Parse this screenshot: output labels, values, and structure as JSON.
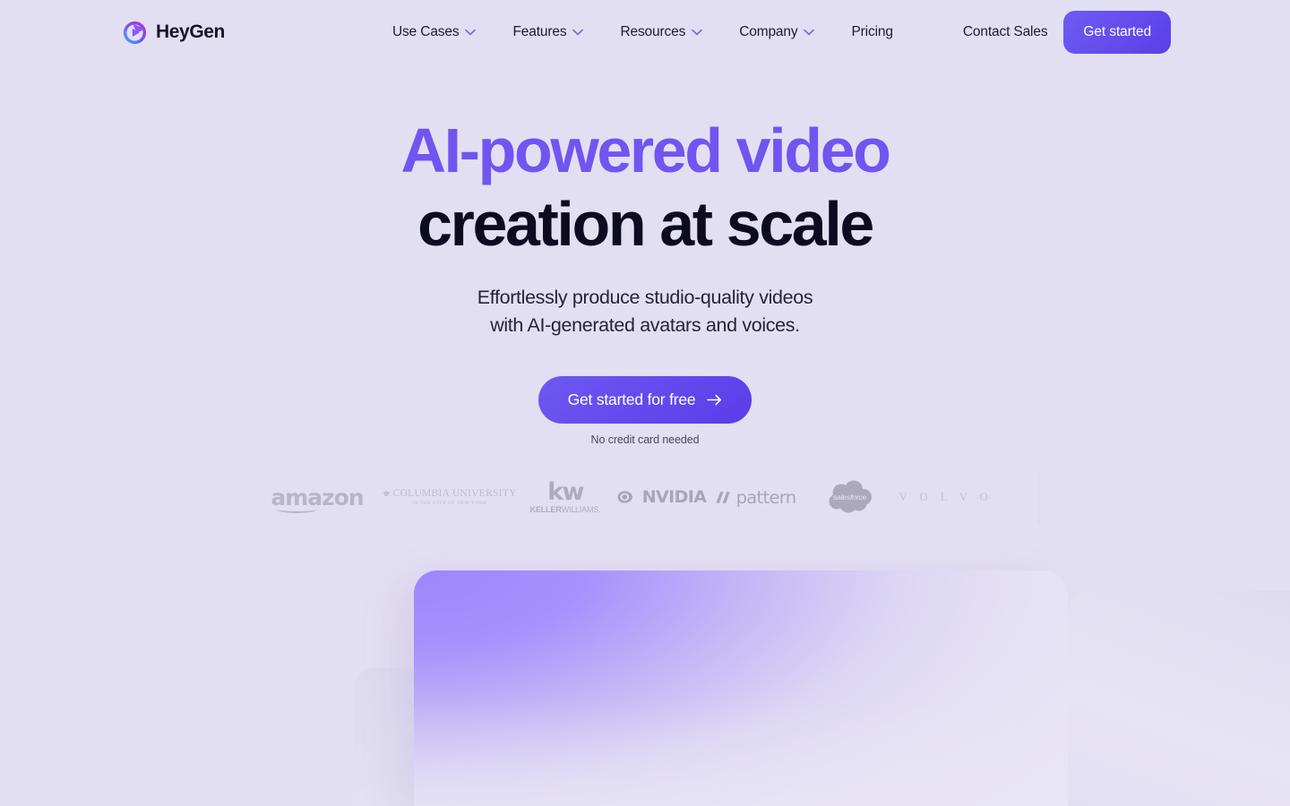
{
  "brand": {
    "name": "HeyGen",
    "logo_icon": "heygen-play-swirl-icon"
  },
  "nav": {
    "items": [
      {
        "label": "Use Cases",
        "has_dropdown": true
      },
      {
        "label": "Features",
        "has_dropdown": true
      },
      {
        "label": "Resources",
        "has_dropdown": true
      },
      {
        "label": "Company",
        "has_dropdown": true
      },
      {
        "label": "Pricing",
        "has_dropdown": false
      }
    ],
    "contact_label": "Contact Sales",
    "cta_label": "Get started"
  },
  "hero": {
    "title_line1": "AI-powered video",
    "title_line2": "creation at scale",
    "sub_line1": "Effortlessly produce studio-quality videos",
    "sub_line2": "with AI-generated avatars and voices.",
    "cta_label": "Get started for free",
    "cta_arrow": "→",
    "cta_note": "No credit card needed"
  },
  "logos": [
    {
      "name": "amazon",
      "text": "amazon"
    },
    {
      "name": "columbia-university",
      "text": "COLUMBIA UNIVERSITY",
      "subtext": "IN THE CITY OF NEW YORK"
    },
    {
      "name": "keller-williams",
      "text": "kw",
      "subtext_bold": "KELLER",
      "subtext_thin": "WILLIAMS."
    },
    {
      "name": "nvidia",
      "text": "NVIDIA"
    },
    {
      "name": "pattern",
      "text": "pattern"
    },
    {
      "name": "salesforce",
      "text": "salesforce"
    },
    {
      "name": "volvo",
      "text": "V O L V O"
    }
  ],
  "colors": {
    "page_background": "#e3dff3",
    "accent_purple": "#7055f0",
    "headline_dark": "#0d0b21",
    "button_gradient_start": "#6e59f2",
    "button_gradient_end": "#5a3ce9",
    "card_gradient_purple": "#9d86fb"
  }
}
